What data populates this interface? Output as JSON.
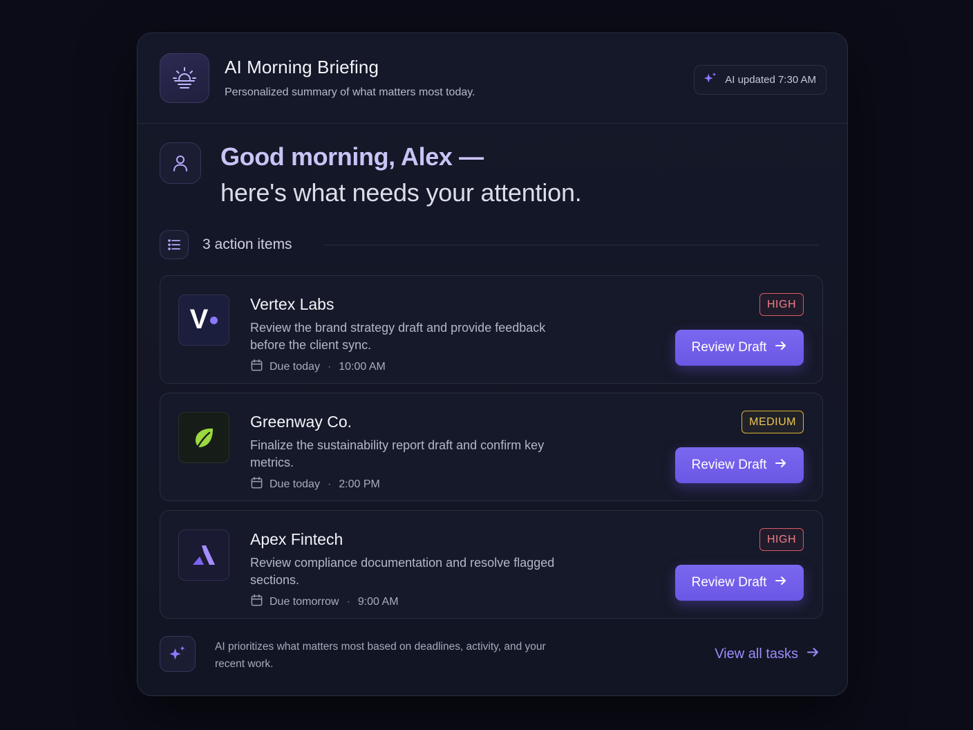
{
  "header": {
    "title": "AI Morning Briefing",
    "subtitle": "Personalized summary of what matters most today.",
    "updated_label": "AI updated 7:30 AM"
  },
  "greeting": {
    "line1": "Good morning, Alex —",
    "line2": "here's what needs your attention."
  },
  "actions": {
    "count_label": "3 action items",
    "items": [
      {
        "company": "Vertex Labs",
        "logo_text": "V",
        "description": "Review the brand strategy draft and provide feedback before the client sync.",
        "due": "Due today",
        "time": "10:00 AM",
        "priority": "HIGH",
        "button_label": "Review Draft"
      },
      {
        "company": "Greenway Co.",
        "logo_icon": "leaf-icon",
        "description": "Finalize the sustainability report draft and confirm key metrics.",
        "due": "Due today",
        "time": "2:00 PM",
        "priority": "MEDIUM",
        "button_label": "Review Draft"
      },
      {
        "company": "Apex Fintech",
        "logo_icon": "apex-triangle-icon",
        "description": "Review compliance documentation and resolve flagged sections.",
        "due": "Due tomorrow",
        "time": "9:00 AM",
        "priority": "HIGH",
        "button_label": "Review Draft"
      }
    ]
  },
  "footer": {
    "note": "AI prioritizes what matters most based on deadlines, activity, and your recent work.",
    "link_label": "View all tasks"
  },
  "colors": {
    "accent": "#7b68f0",
    "high": "#f07f86",
    "medium": "#efc552",
    "background": "#0b0c17"
  }
}
